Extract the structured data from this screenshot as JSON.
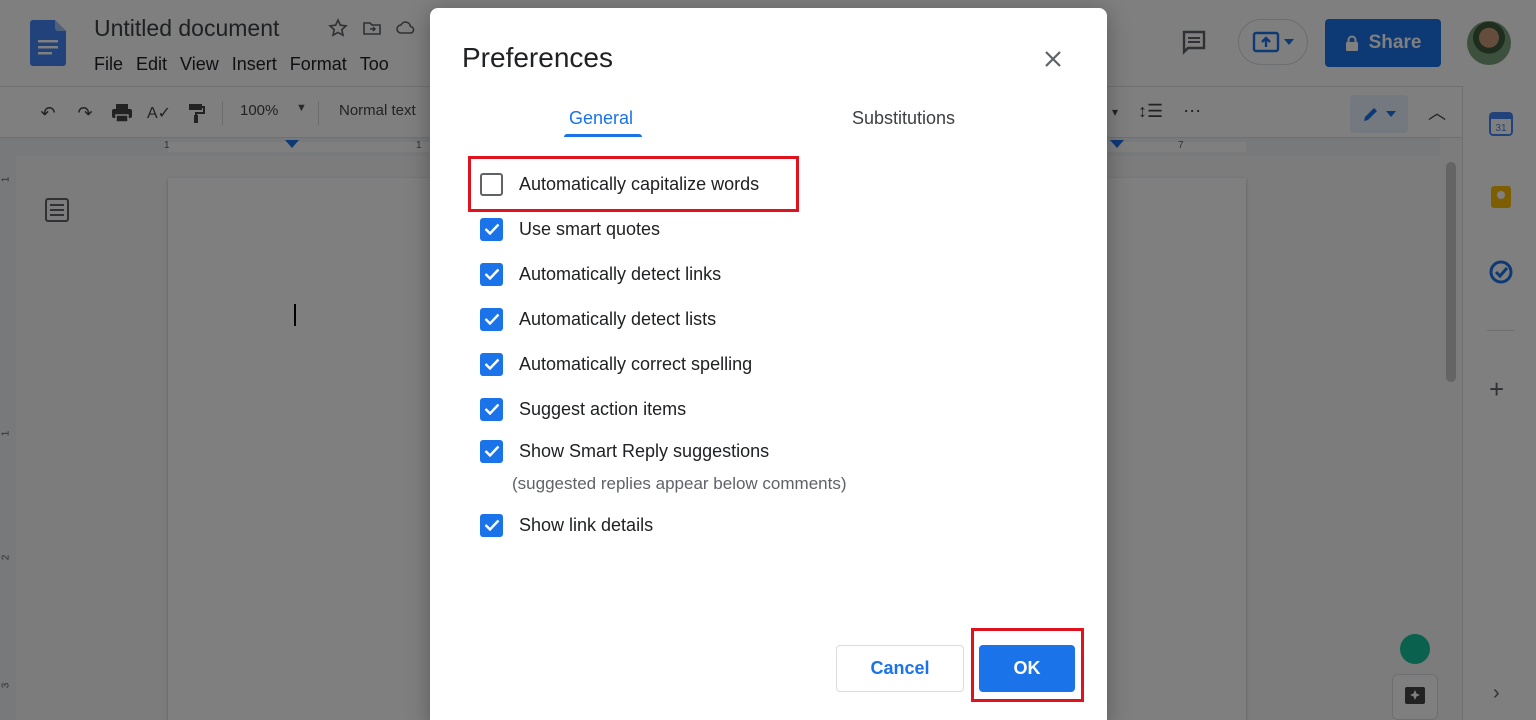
{
  "app": {
    "title": "Untitled document",
    "menus": [
      "File",
      "Edit",
      "View",
      "Insert",
      "Format",
      "Too"
    ],
    "share_label": "Share",
    "toolbar": {
      "zoom": "100%",
      "style": "Normal text"
    },
    "ruler": {
      "marks": [
        "1",
        "1",
        "7"
      ]
    },
    "vruler": {
      "marks": [
        "1",
        "1",
        "2",
        "3"
      ]
    }
  },
  "dialog": {
    "title": "Preferences",
    "tabs": [
      {
        "label": "General",
        "active": true
      },
      {
        "label": "Substitutions",
        "active": false
      }
    ],
    "options": [
      {
        "label": "Automatically capitalize words",
        "checked": false
      },
      {
        "label": "Use smart quotes",
        "checked": true
      },
      {
        "label": "Automatically detect links",
        "checked": true
      },
      {
        "label": "Automatically detect lists",
        "checked": true
      },
      {
        "label": "Automatically correct spelling",
        "checked": true
      },
      {
        "label": "Suggest action items",
        "checked": true
      },
      {
        "label": "Show Smart Reply suggestions",
        "checked": true
      },
      {
        "label": "Show link details",
        "checked": true
      }
    ],
    "smart_reply_hint": "(suggested replies appear below comments)",
    "cancel_label": "Cancel",
    "ok_label": "OK"
  },
  "colors": {
    "accent": "#1a73e8",
    "highlight": "#e0121d"
  },
  "icons": {
    "close": "close-icon",
    "checkbox_checked": "check-icon"
  }
}
